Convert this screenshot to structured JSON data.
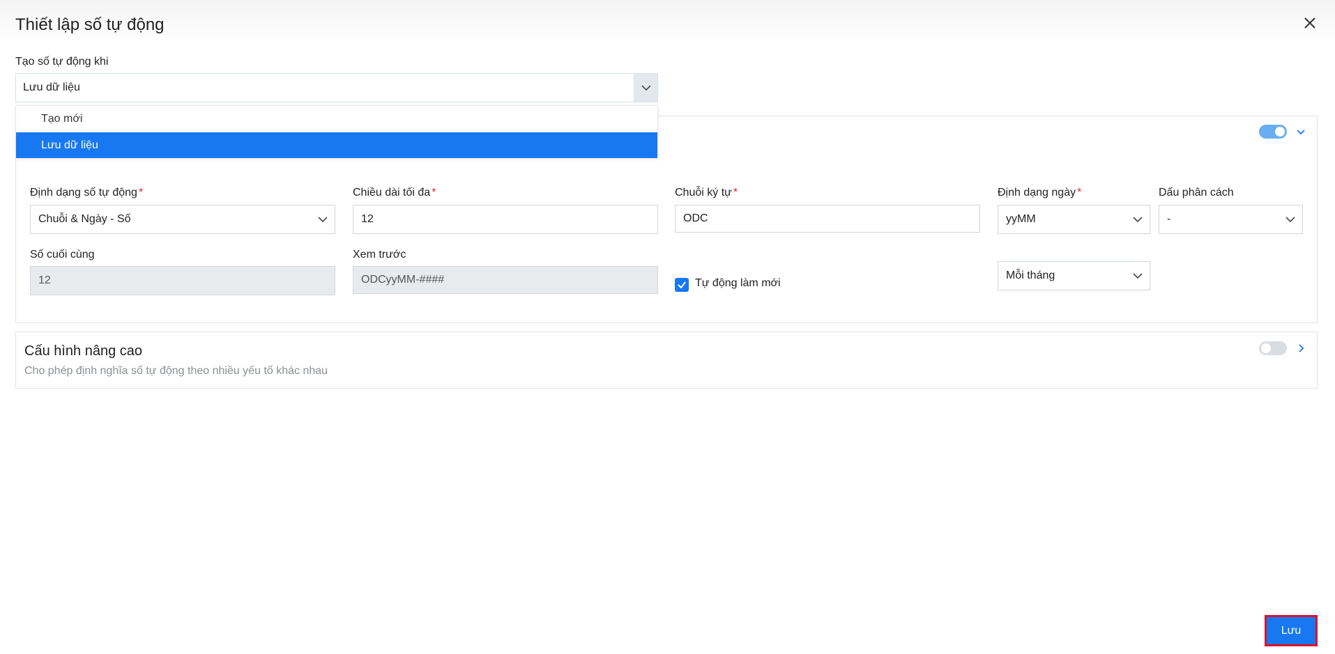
{
  "dialog": {
    "title": "Thiết lập số tự động"
  },
  "trigger": {
    "label": "Tạo số tự động khi",
    "value": "Lưu dữ liệu",
    "options": [
      "Tạo mới",
      "Lưu dữ liệu"
    ],
    "selected_index": 1
  },
  "basic_config": {
    "enabled": true,
    "format": {
      "label": "Định dạng số tự động",
      "value": "Chuỗi & Ngày - Số",
      "required": "*"
    },
    "max_length": {
      "label": "Chiều dài tối đa",
      "value": "12",
      "required": "*"
    },
    "prefix": {
      "label": "Chuỗi ký tự",
      "value": "ODC",
      "required": "*"
    },
    "date_format": {
      "label": "Định dạng ngày",
      "value": "yyMM",
      "required": "*"
    },
    "separator": {
      "label": "Dấu phân cách",
      "value": "-"
    },
    "last_number": {
      "label": "Số cuối cùng",
      "value": "12"
    },
    "preview": {
      "label": "Xem trước",
      "value": "ODCyyMM-####"
    },
    "auto_reset": {
      "label": "Tự động làm mới",
      "checked": true
    },
    "reset_period": {
      "value": "Mỗi tháng"
    }
  },
  "advanced_config": {
    "title": "Cấu hình nâng cao",
    "description": "Cho phép định nghĩa số tự động theo nhiều yếu tố khác nhau",
    "enabled": false
  },
  "footer": {
    "save_label": "Lưu"
  },
  "colors": {
    "primary": "#1778f2",
    "toggle_on": "#6aaef2",
    "toggle_off": "#d9dde1",
    "required": "#e0243a",
    "highlight_border": "#e0102a"
  }
}
